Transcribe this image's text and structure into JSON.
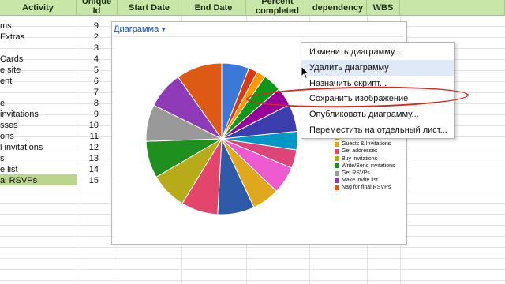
{
  "sheet": {
    "headers": {
      "activity": "Activity",
      "unique_id": [
        "Unique",
        "Id"
      ],
      "start_date": "Start Date",
      "end_date": "End Date",
      "percent_completed": [
        "Percent",
        "completed"
      ],
      "dependency": "dependency",
      "wbs": "WBS"
    },
    "rows": [
      {
        "activity": "ms",
        "id": "9"
      },
      {
        "activity": "Extras",
        "id": "2"
      },
      {
        "activity": "",
        "id": "3"
      },
      {
        "activity": "Cards",
        "id": "4"
      },
      {
        "activity": "e site",
        "id": "5"
      },
      {
        "activity": "ent",
        "id": "6"
      },
      {
        "activity": "",
        "id": "7"
      },
      {
        "activity": "e",
        "id": "8"
      },
      {
        "activity": "invitations",
        "id": "9"
      },
      {
        "activity": "sses",
        "id": "10"
      },
      {
        "activity": "ons",
        "id": "11"
      },
      {
        "activity": "l invitations",
        "id": "12"
      },
      {
        "activity": "s",
        "id": "13"
      },
      {
        "activity": "e list",
        "id": "14"
      },
      {
        "activity": "al RSVPs",
        "id": "15"
      }
    ],
    "selected_row_index": 14,
    "header_color": "#c7e6a8",
    "selected_color": "#b9d58f"
  },
  "chart": {
    "tab_label": "Диаграмма",
    "tab_icon": "chevron-down-icon",
    "chart_data": {
      "type": "pie",
      "slices": [
        {
          "label": "",
          "value": 6.1,
          "color": "#3c78d8"
        },
        {
          "label": "",
          "value": 2.0,
          "color": "#dc3912"
        },
        {
          "label": "",
          "value": 2.0,
          "color": "#ff9900"
        },
        {
          "label": "",
          "value": 4.1,
          "color": "#109618"
        },
        {
          "label": "",
          "value": 4.1,
          "color": "#990099"
        },
        {
          "label": "",
          "value": 6.1,
          "color": "#3b3eac"
        },
        {
          "label": "",
          "value": 4.1,
          "color": "#0099c6"
        },
        {
          "label": "",
          "value": 4.1,
          "color": "#dd4477"
        },
        {
          "label": "Pick a date",
          "value": 6.1,
          "color": "#ee5ad0"
        },
        {
          "label": "Guests & Invitations",
          "value": 6.1,
          "color": "#e0a81c"
        },
        {
          "label": "Get addresses",
          "value": 8.2,
          "color": "#2e5aa8"
        },
        {
          "label": "Buy invitations",
          "value": 8.2,
          "color": "#e3466a"
        },
        {
          "label": "Write/Send invitations",
          "value": 8.2,
          "color": "#b8ab1a"
        },
        {
          "label": "Get RSVPs",
          "value": 8.2,
          "color": "#1f8f1f"
        },
        {
          "label": "Make invite list",
          "value": 8.2,
          "color": "#999999"
        },
        {
          "label": "Nag for final RSVPs",
          "value": 8.2,
          "color": "#8f3bb8"
        },
        {
          "label": "",
          "value": 10.2,
          "color": "#dc5a14"
        }
      ],
      "legend_visible": [
        {
          "label": "Pick a date",
          "color": "#e0a81c"
        },
        {
          "label": "Guests & Invitations",
          "color": "#e0a81c"
        },
        {
          "label": "Get addresses",
          "color": "#e3466a"
        },
        {
          "label": "Buy invitations",
          "color": "#b8ab1a"
        },
        {
          "label": "Write/Send invitations",
          "color": "#1f8f1f"
        },
        {
          "label": "Get RSVPs",
          "color": "#999999"
        },
        {
          "label": "Make invite list",
          "color": "#8f3bb8"
        },
        {
          "label": "Nag for final RSVPs",
          "color": "#dc5a14"
        }
      ]
    }
  },
  "context_menu": {
    "items": [
      {
        "label": "Изменить диаграмму...",
        "highlighted": false
      },
      {
        "label": "Удалить диаграмму",
        "highlighted": true
      },
      {
        "label": "Назначить скрипт...",
        "highlighted": false
      },
      {
        "label": "Сохранить изображение",
        "highlighted": false
      },
      {
        "label": "Опубликовать диаграмму...",
        "highlighted": false
      },
      {
        "label": "Переместить на отдельный лист...",
        "highlighted": false
      }
    ],
    "highlight_color": "#dfe9f7",
    "annotation_color": "#d9271d"
  }
}
